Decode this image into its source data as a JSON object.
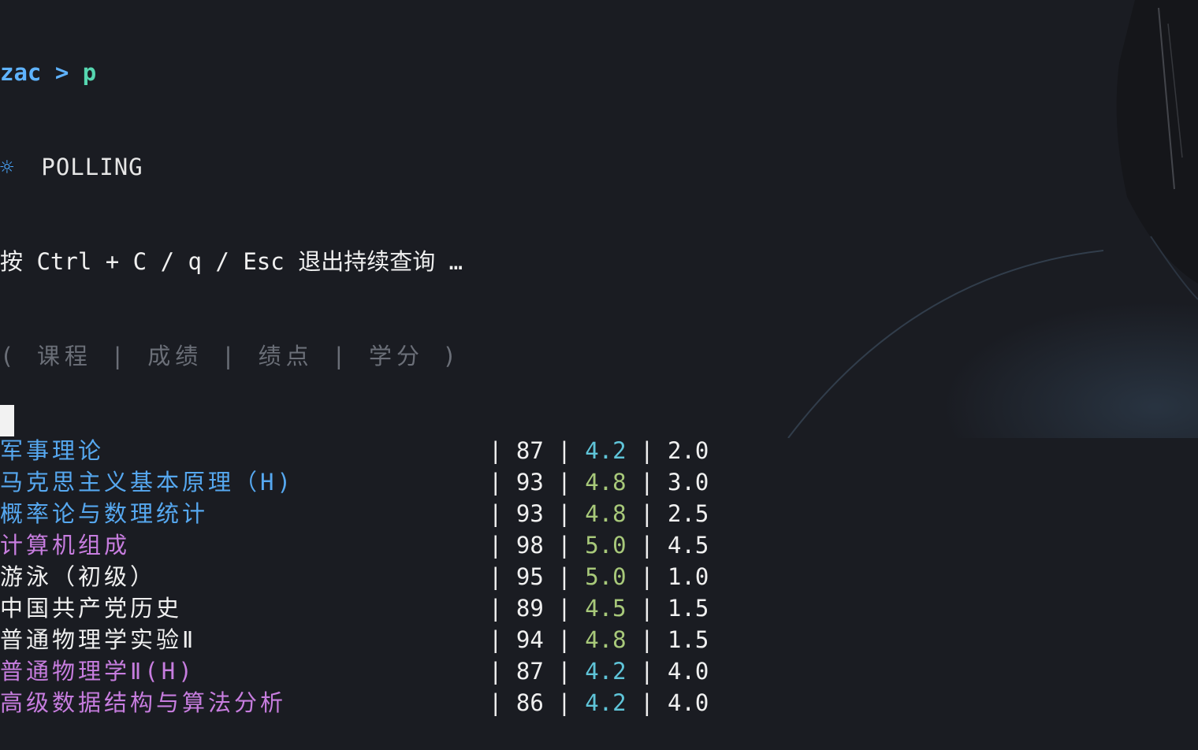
{
  "prompt": {
    "user": "zac",
    "separator": ">",
    "command": "p"
  },
  "status": {
    "icon": "gear-icon",
    "text": "POLLING"
  },
  "hint": "按 Ctrl + C / q / Esc 退出持续查询 …",
  "header": "( 课程 | 成绩 | 绩点 | 学分 )",
  "rows": [
    {
      "course": "军事理论",
      "score": "87",
      "gpa": "4.2",
      "credit": "2.0",
      "course_color": "blue",
      "gpa_color": "cyan"
    },
    {
      "course": "马克思主义基本原理（H)",
      "score": "93",
      "gpa": "4.8",
      "credit": "3.0",
      "course_color": "blue",
      "gpa_color": "green"
    },
    {
      "course": "概率论与数理统计",
      "score": "93",
      "gpa": "4.8",
      "credit": "2.5",
      "course_color": "blue",
      "gpa_color": "green"
    },
    {
      "course": "计算机组成",
      "score": "98",
      "gpa": "5.0",
      "credit": "4.5",
      "course_color": "purple",
      "gpa_color": "green"
    },
    {
      "course": "游泳（初级）",
      "score": "95",
      "gpa": "5.0",
      "credit": "1.0",
      "course_color": "white",
      "gpa_color": "green"
    },
    {
      "course": "中国共产党历史",
      "score": "89",
      "gpa": "4.5",
      "credit": "1.5",
      "course_color": "white",
      "gpa_color": "green"
    },
    {
      "course": "普通物理学实验Ⅱ",
      "score": "94",
      "gpa": "4.8",
      "credit": "1.5",
      "course_color": "white",
      "gpa_color": "green"
    },
    {
      "course": "普通物理学Ⅱ(H)",
      "score": "87",
      "gpa": "4.2",
      "credit": "4.0",
      "course_color": "purple",
      "gpa_color": "cyan"
    },
    {
      "course": "高级数据结构与算法分析",
      "score": "86",
      "gpa": "4.2",
      "credit": "4.0",
      "course_color": "purple",
      "gpa_color": "cyan"
    }
  ],
  "colors": {
    "background": "#1a1c22",
    "blue": "#56a8f0",
    "purple": "#c77ddf",
    "white": "#f0f0f0",
    "cyan": "#5fc4d8",
    "green": "#a8c97a",
    "header_gray": "#6b6f78"
  }
}
